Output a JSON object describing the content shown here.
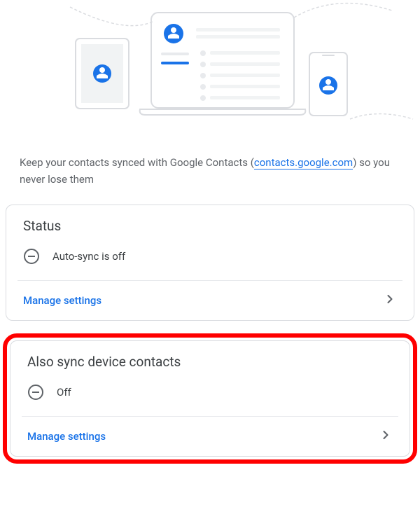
{
  "description": {
    "text_before": "Keep your contacts synced with Google Contacts (",
    "link_text": "contacts.google.com",
    "text_after": ") so you never lose them"
  },
  "card1": {
    "title": "Status",
    "status_text": "Auto-sync is off",
    "manage_label": "Manage settings"
  },
  "card2": {
    "title": "Also sync device contacts",
    "status_text": "Off",
    "manage_label": "Manage settings"
  }
}
